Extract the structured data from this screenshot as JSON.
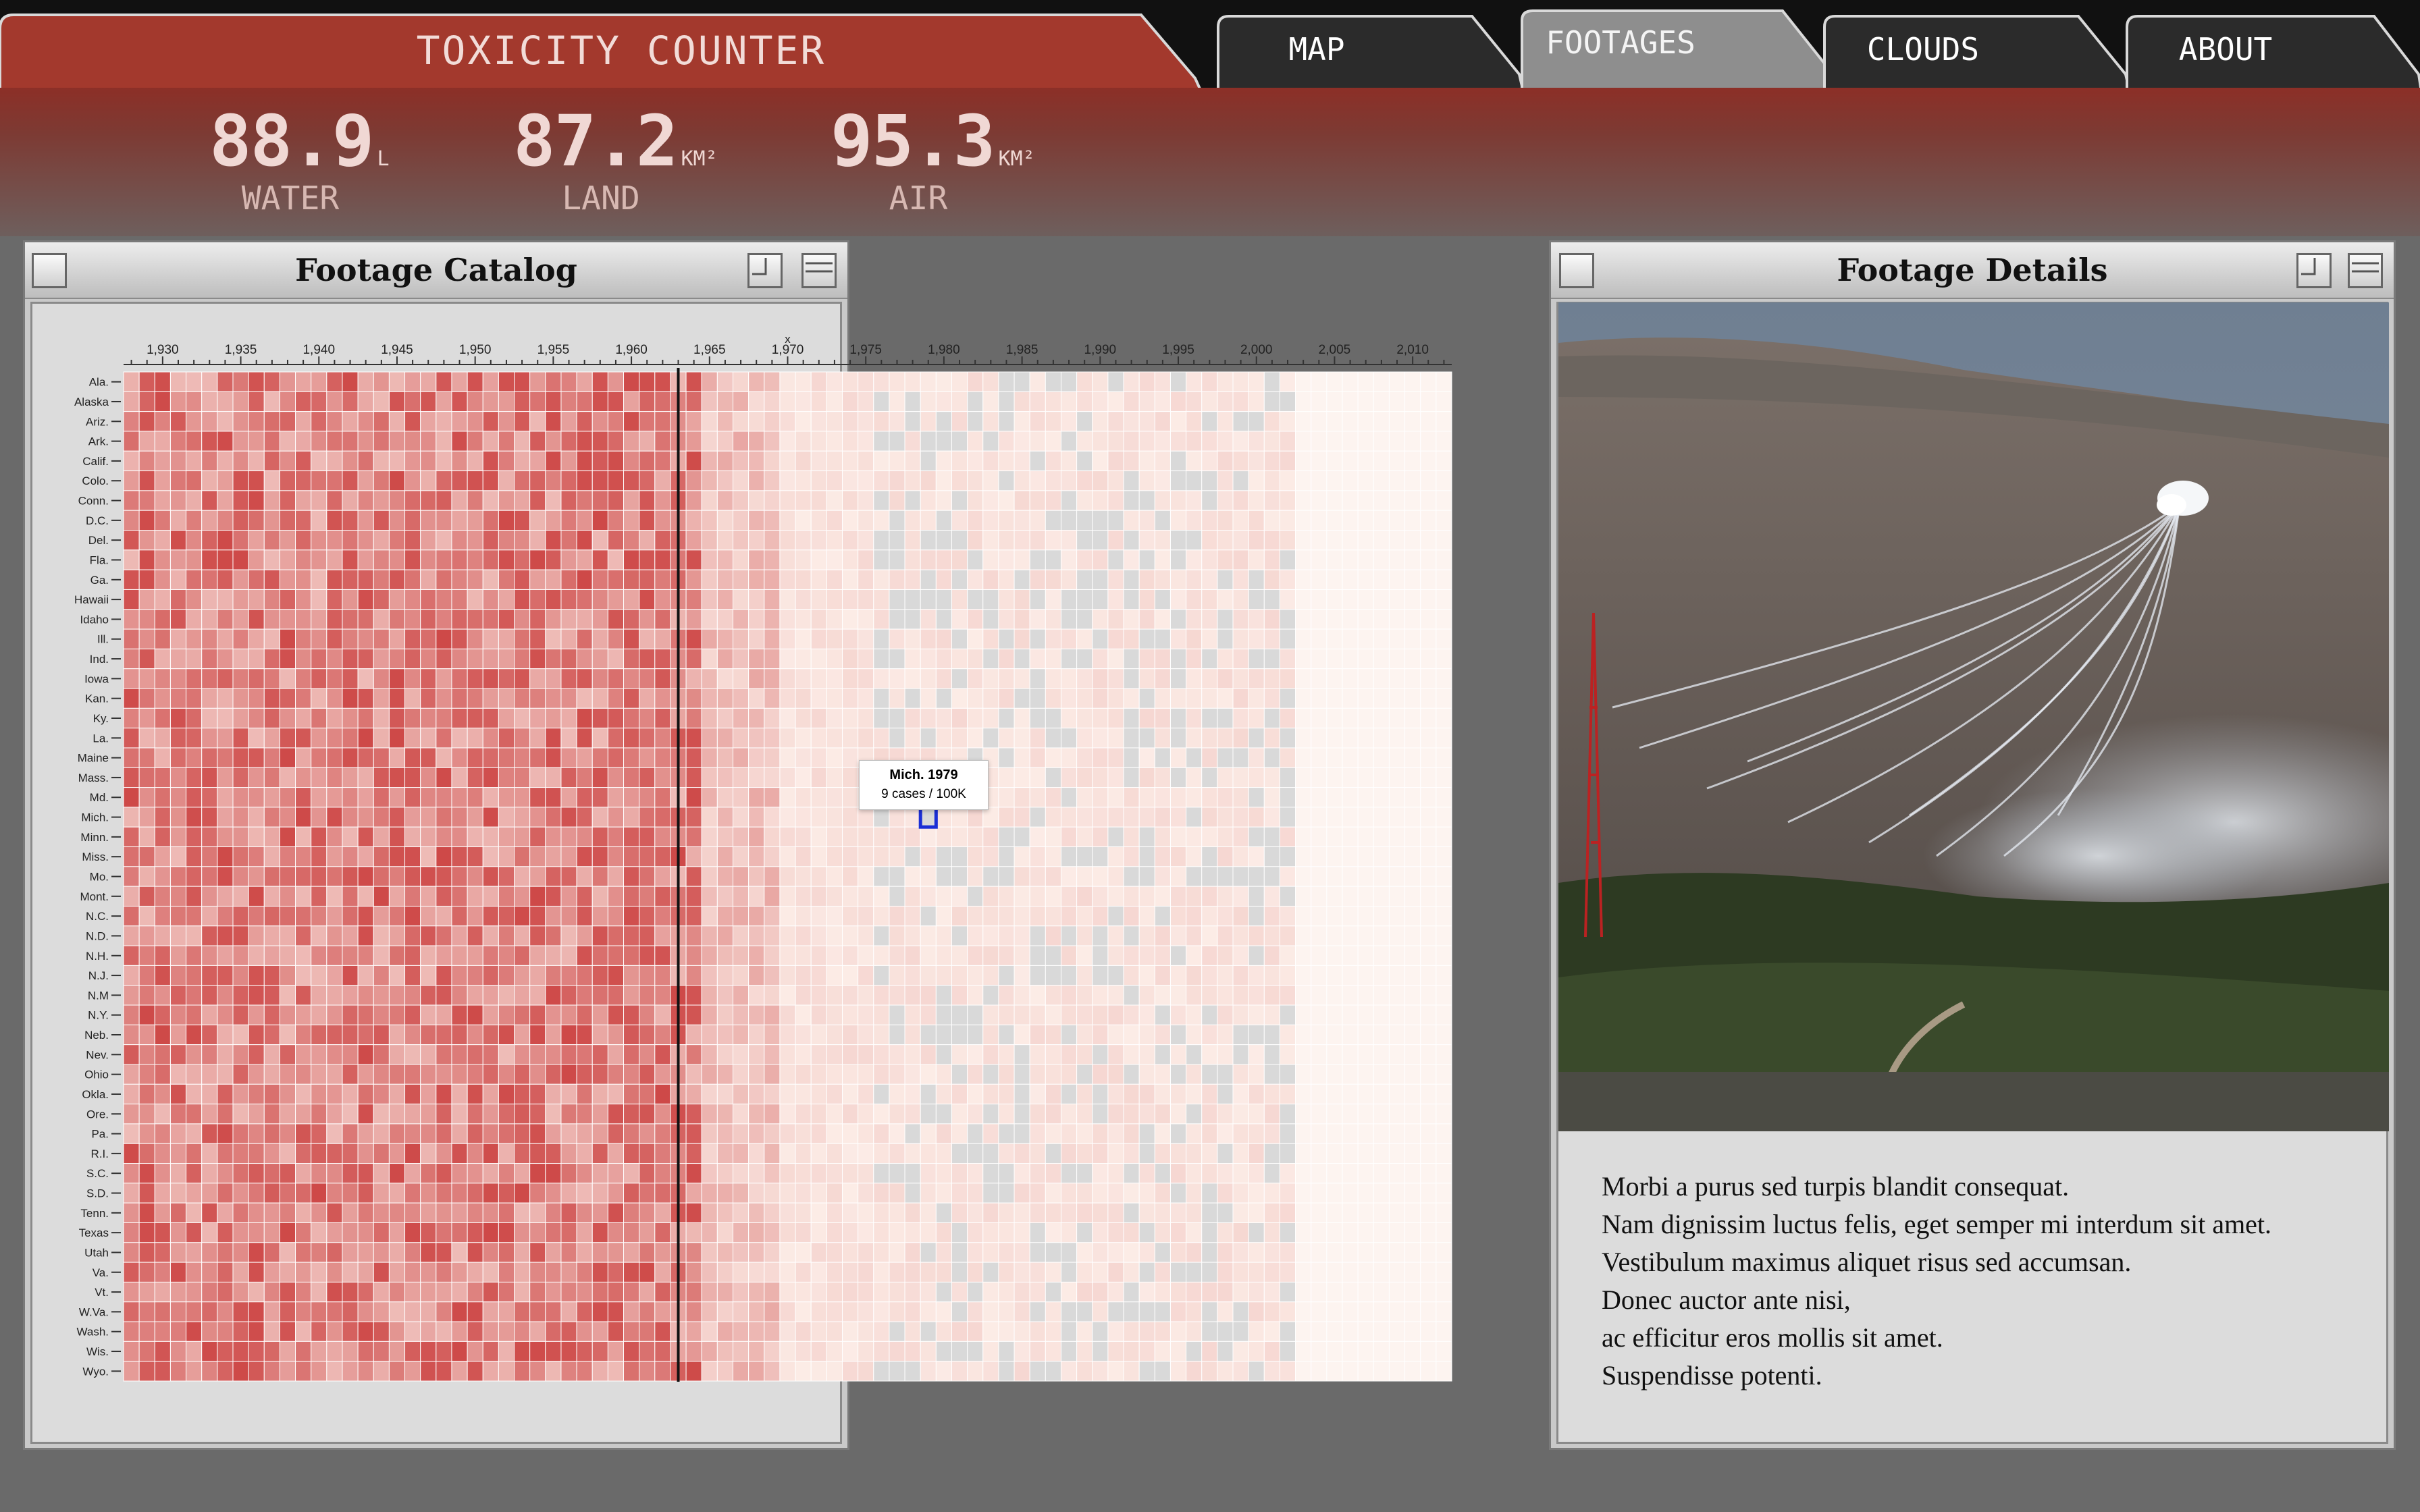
{
  "app": {
    "title": "TOXICITY COUNTER",
    "tabs": [
      {
        "label": "MAP",
        "active": false
      },
      {
        "label": "FOOTAGES",
        "active": true
      },
      {
        "label": "CLOUDS",
        "active": false
      },
      {
        "label": "ABOUT",
        "active": false
      }
    ]
  },
  "metrics": [
    {
      "value": "88.9",
      "unit": "L",
      "label": "WATER"
    },
    {
      "value": "87.2",
      "unit": "KM²",
      "label": "LAND"
    },
    {
      "value": "95.3",
      "unit": "KM²",
      "label": "AIR"
    }
  ],
  "catalog": {
    "title": "Footage Catalog",
    "tooltip": {
      "title": "Mich. 1979",
      "value": "9 cases / 100K"
    }
  },
  "details": {
    "title": "Footage Details",
    "description": [
      "Morbi a purus sed turpis blandit consequat.",
      "Nam dignissim luctus felis, eget semper mi interdum sit amet.",
      "Vestibulum maximus aliquet risus sed accumsan.",
      "Donec auctor ante nisi,",
      "ac efficitur eros mollis sit amet.",
      "Suspendisse potenti."
    ]
  },
  "colors": {
    "accent": "#a3392d",
    "tab_dark": "#2b2b2b",
    "tab_active": "#8e8e8e",
    "cell_high": "#c21f1f",
    "cell_low": "#fdf0ea",
    "missing": "#d9d9d9"
  },
  "chart_data": {
    "type": "heatmap",
    "xlabel": "x",
    "x_ticks": [
      "1,930",
      "1,935",
      "1,940",
      "1,945",
      "1,950",
      "1,955",
      "1,960",
      "1,965",
      "1,970",
      "1,975",
      "1,980",
      "1,985",
      "1,990",
      "1,995",
      "2,000",
      "2,005",
      "2,010"
    ],
    "x_range": [
      1928,
      2012
    ],
    "marker_year": 1963,
    "highlight": {
      "state": "Mich.",
      "year": 1979,
      "value": 9,
      "unit": "cases / 100K"
    },
    "rows": [
      "Ala.",
      "Alaska",
      "Ariz.",
      "Ark.",
      "Calif.",
      "Colo.",
      "Conn.",
      "D.C.",
      "Del.",
      "Fla.",
      "Ga.",
      "Hawaii",
      "Idaho",
      "Ill.",
      "Ind.",
      "Iowa",
      "Kan.",
      "Ky.",
      "La.",
      "Maine",
      "Mass.",
      "Md.",
      "Mich.",
      "Minn.",
      "Miss.",
      "Mo.",
      "Mont.",
      "N.C.",
      "N.D.",
      "N.H.",
      "N.J.",
      "N.M",
      "N.Y.",
      "Neb.",
      "Nev.",
      "Ohio",
      "Okla.",
      "Ore.",
      "Pa.",
      "R.I.",
      "S.C.",
      "S.D.",
      "Tenn.",
      "Texas",
      "Utah",
      "Va.",
      "Vt.",
      "W.Va.",
      "Wash.",
      "Wis.",
      "Wyo."
    ],
    "value_note": "cases / 100K",
    "grid": true
  }
}
